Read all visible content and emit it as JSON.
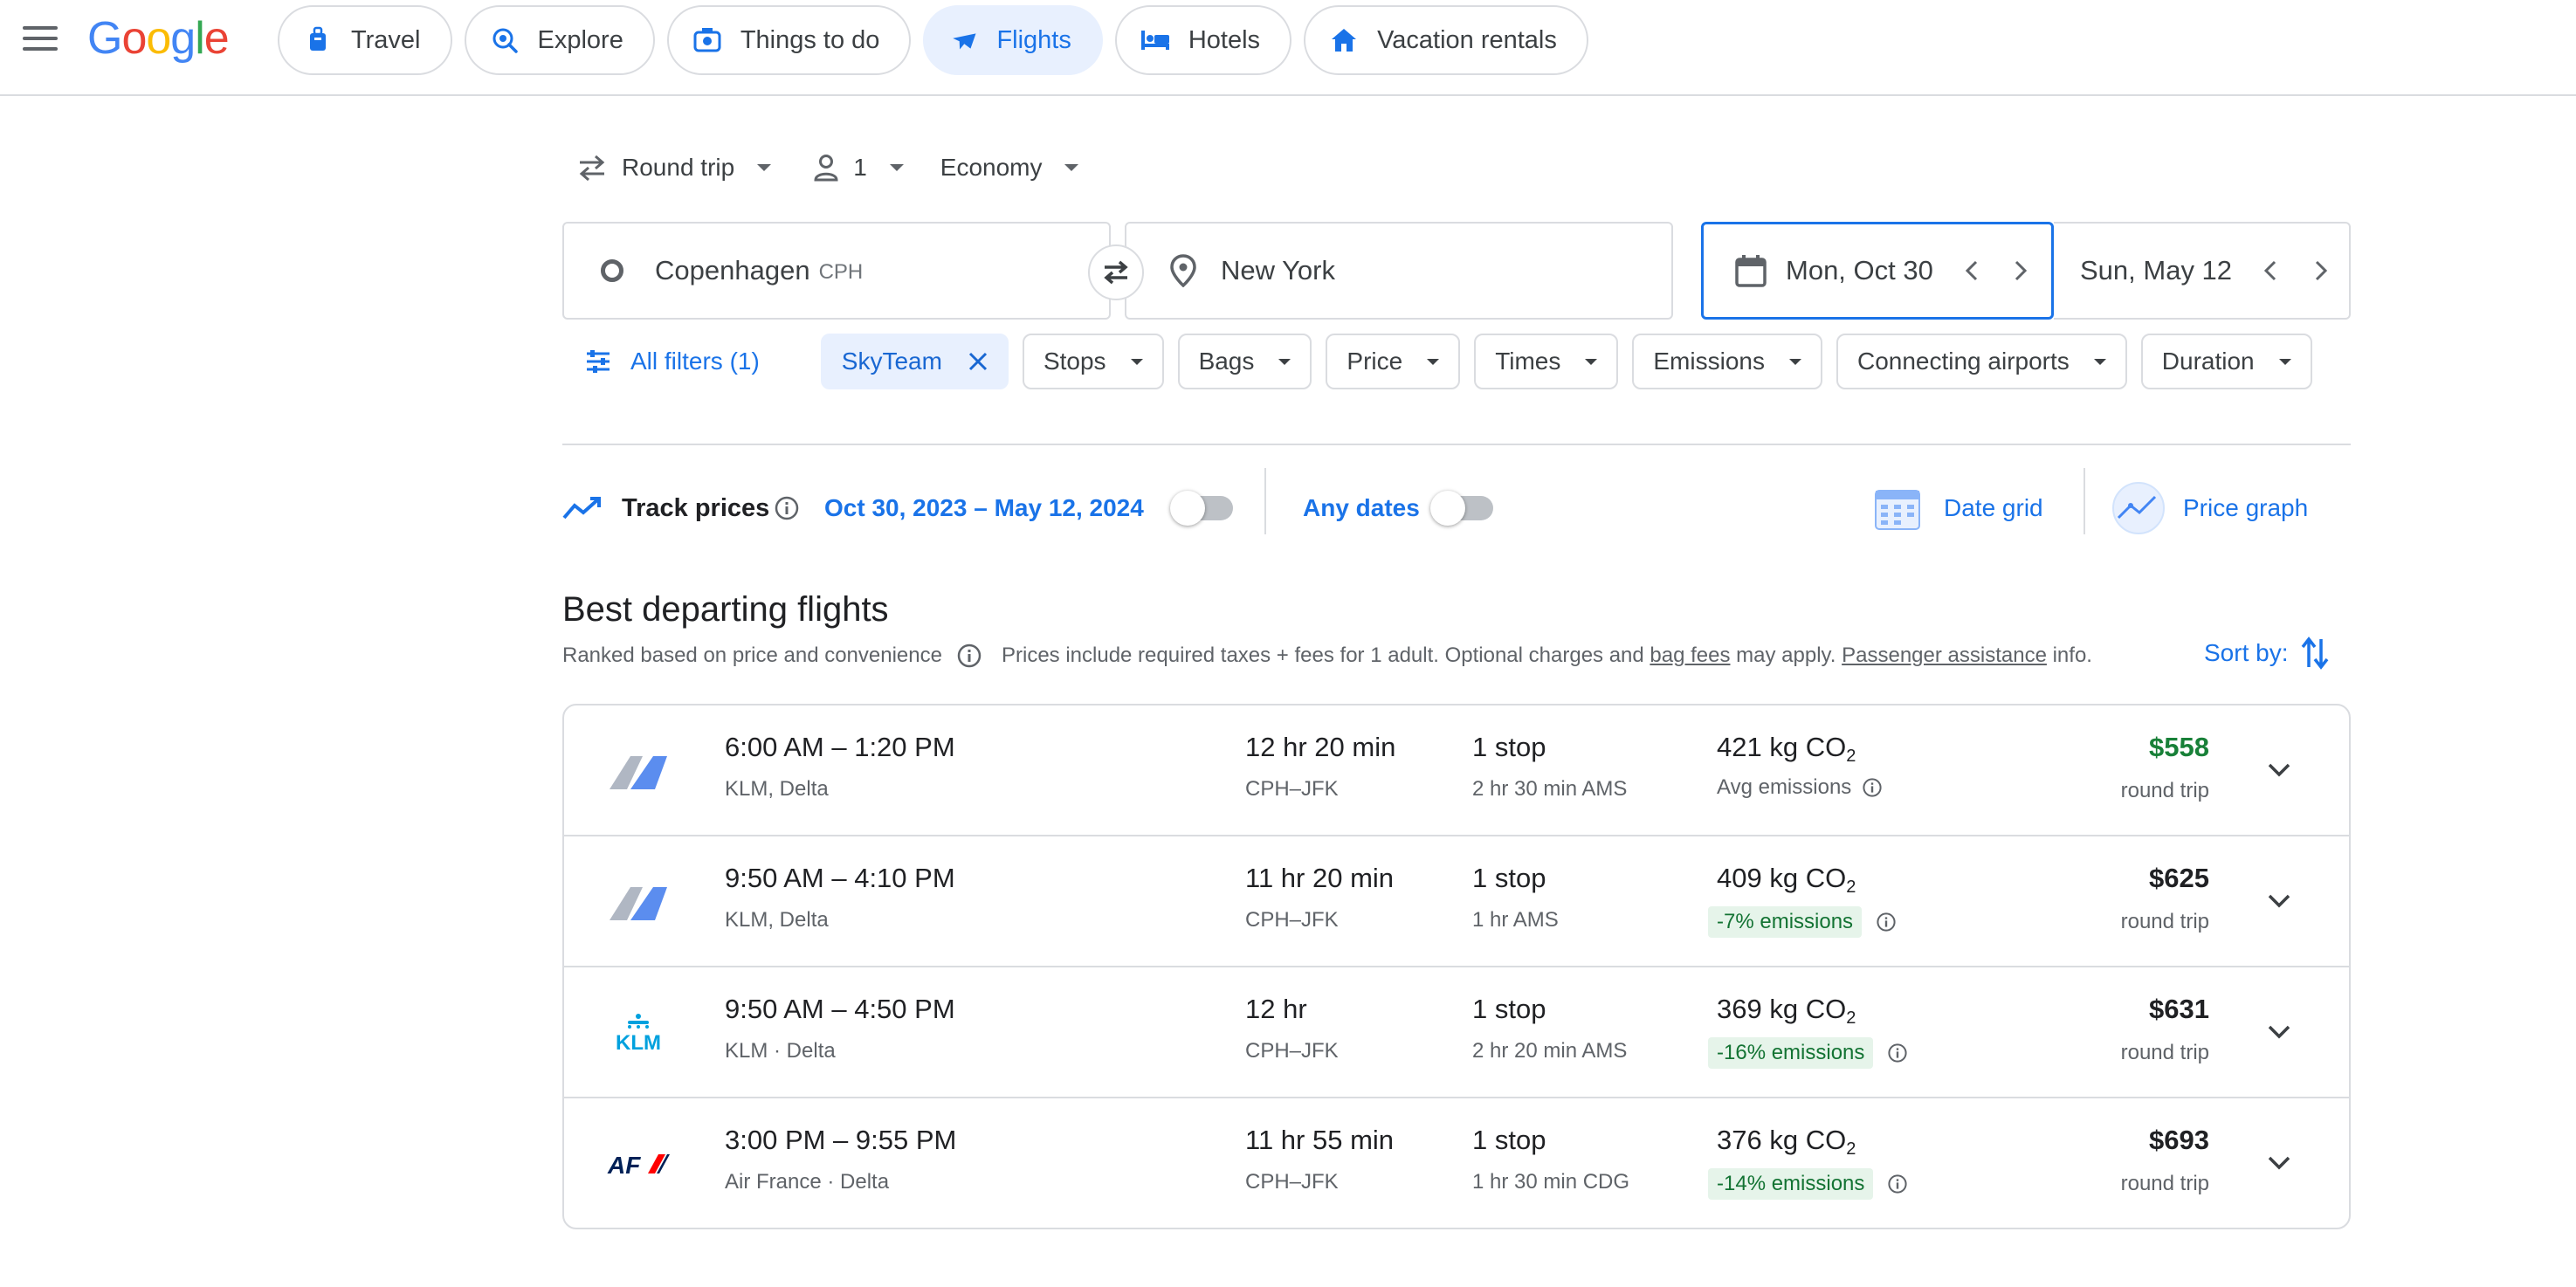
{
  "logo": {
    "letters": [
      "G",
      "o",
      "o",
      "g",
      "l",
      "e"
    ],
    "colors": [
      "#4285F4",
      "#EA4335",
      "#FBBC05",
      "#4285F4",
      "#34A853",
      "#EA4335"
    ]
  },
  "nav": {
    "tabs": [
      {
        "label": "Travel",
        "icon": "luggage-icon"
      },
      {
        "label": "Explore",
        "icon": "explore-icon"
      },
      {
        "label": "Things to do",
        "icon": "camera-icon"
      },
      {
        "label": "Flights",
        "icon": "airplane-icon",
        "active": true
      },
      {
        "label": "Hotels",
        "icon": "bed-icon"
      },
      {
        "label": "Vacation rentals",
        "icon": "house-icon"
      }
    ]
  },
  "search": {
    "trip_type": "Round trip",
    "passengers": "1",
    "cabin": "Economy",
    "origin": "Copenhagen",
    "origin_code": "CPH",
    "destination": "New York",
    "depart_date": "Mon, Oct 30",
    "return_date": "Sun, May 12"
  },
  "filters": {
    "all_filters": "All filters (1)",
    "selected_chip": "SkyTeam",
    "chips": [
      "Stops",
      "Bags",
      "Price",
      "Times",
      "Emissions",
      "Connecting airports",
      "Duration"
    ]
  },
  "track": {
    "label": "Track prices",
    "date_range": "Oct 30, 2023 – May 12, 2024",
    "any_dates": "Any dates",
    "date_grid": "Date grid",
    "price_graph": "Price graph"
  },
  "results": {
    "heading": "Best departing flights",
    "ranked": "Ranked based on price and convenience",
    "prices_note_1": "Prices include required taxes + fees for 1 adult. Optional charges and",
    "bag_fees": "bag fees",
    "prices_note_2": "may apply.",
    "passenger_assistance": "Passenger assistance",
    "prices_note_3": "info.",
    "sort_by": "Sort by:",
    "flights": [
      {
        "logo": "klm-delta",
        "times": "6:00 AM – 1:20 PM",
        "airline": "KLM, Delta",
        "duration": "12 hr 20 min",
        "route": "CPH–JFK",
        "stops": "1 stop",
        "stop_info": "2 hr 30 min AMS",
        "co2": "421 kg CO",
        "emissions": "Avg emissions",
        "emissions_badge": false,
        "price": "$558",
        "price_low": true,
        "price_sub": "round trip"
      },
      {
        "logo": "klm-delta",
        "times": "9:50 AM – 4:10 PM",
        "airline": "KLM, Delta",
        "duration": "11 hr 20 min",
        "route": "CPH–JFK",
        "stops": "1 stop",
        "stop_info": "1 hr AMS",
        "co2": "409 kg CO",
        "emissions": "-7% emissions",
        "emissions_badge": true,
        "price": "$625",
        "price_low": false,
        "price_sub": "round trip"
      },
      {
        "logo": "klm",
        "times": "9:50 AM – 4:50 PM",
        "airline": "KLM · Delta",
        "duration": "12 hr",
        "route": "CPH–JFK",
        "stops": "1 stop",
        "stop_info": "2 hr 20 min AMS",
        "co2": "369 kg CO",
        "emissions": "-16% emissions",
        "emissions_badge": true,
        "price": "$631",
        "price_low": false,
        "price_sub": "round trip"
      },
      {
        "logo": "airfrance",
        "times": "3:00 PM – 9:55 PM",
        "airline": "Air France · Delta",
        "duration": "11 hr 55 min",
        "route": "CPH–JFK",
        "stops": "1 stop",
        "stop_info": "1 hr 30 min CDG",
        "co2": "376 kg CO",
        "emissions": "-14% emissions",
        "emissions_badge": true,
        "price": "$693",
        "price_low": false,
        "price_sub": "round trip"
      }
    ]
  }
}
